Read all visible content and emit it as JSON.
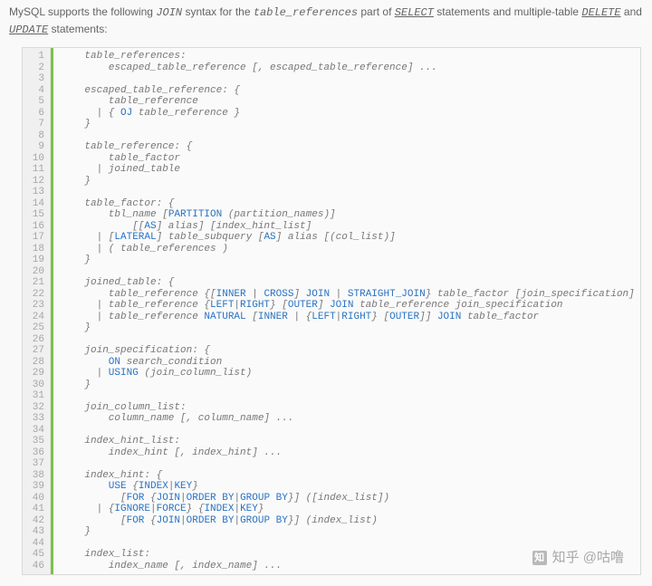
{
  "intro": {
    "t1": "MySQL supports the following ",
    "join": "JOIN",
    "t2": " syntax for the ",
    "tr": "table_references",
    "t3": " part of ",
    "sel": "SELECT",
    "t4": " statements and multiple-table ",
    "del": "DELETE",
    "t5": " and ",
    "upd": "UPDATE",
    "t6": " statements:"
  },
  "lines": 46,
  "code": [
    {
      "t": "table_references:",
      "i": 1
    },
    {
      "t": "escaped_table_reference [, escaped_table_reference] ...",
      "i": 2
    },
    {
      "t": "",
      "i": 0
    },
    {
      "t": "escaped_table_reference: {",
      "i": 1
    },
    {
      "t": "table_reference",
      "i": 2
    },
    {
      "seg": [
        {
          "p": "  | { "
        },
        {
          "k": "OJ"
        },
        {
          "p": " table_reference }"
        }
      ],
      "i": 1
    },
    {
      "t": "}",
      "i": 1
    },
    {
      "t": "",
      "i": 0
    },
    {
      "t": "table_reference: {",
      "i": 1
    },
    {
      "t": "table_factor",
      "i": 2
    },
    {
      "t": "  | joined_table",
      "i": 1
    },
    {
      "t": "}",
      "i": 1
    },
    {
      "t": "",
      "i": 0
    },
    {
      "t": "table_factor: {",
      "i": 1
    },
    {
      "seg": [
        {
          "p": "tbl_name ["
        },
        {
          "k": "PARTITION"
        },
        {
          "p": " (partition_names)]"
        }
      ],
      "i": 2
    },
    {
      "seg": [
        {
          "p": "    [["
        },
        {
          "k": "AS"
        },
        {
          "p": "] alias] [index_hint_list]"
        }
      ],
      "i": 2
    },
    {
      "seg": [
        {
          "p": "  | ["
        },
        {
          "k": "LATERAL"
        },
        {
          "p": "] table_subquery ["
        },
        {
          "k": "AS"
        },
        {
          "p": "] alias [(col_list)]"
        }
      ],
      "i": 1
    },
    {
      "t": "  | ( table_references )",
      "i": 1
    },
    {
      "t": "}",
      "i": 1
    },
    {
      "t": "",
      "i": 0
    },
    {
      "t": "joined_table: {",
      "i": 1
    },
    {
      "seg": [
        {
          "p": "table_reference {["
        },
        {
          "k": "INNER"
        },
        {
          "p": " | "
        },
        {
          "k": "CROSS"
        },
        {
          "p": "] "
        },
        {
          "k": "JOIN"
        },
        {
          "p": " | "
        },
        {
          "k": "STRAIGHT_JOIN"
        },
        {
          "p": "} table_factor [join_specification]"
        }
      ],
      "i": 2
    },
    {
      "seg": [
        {
          "p": "  | table_reference {"
        },
        {
          "k": "LEFT"
        },
        {
          "p": "|"
        },
        {
          "k": "RIGHT"
        },
        {
          "p": "} ["
        },
        {
          "k": "OUTER"
        },
        {
          "p": "] "
        },
        {
          "k": "JOIN"
        },
        {
          "p": " table_reference join_specification"
        }
      ],
      "i": 1
    },
    {
      "seg": [
        {
          "p": "  | table_reference "
        },
        {
          "k": "NATURAL"
        },
        {
          "p": " ["
        },
        {
          "k": "INNER"
        },
        {
          "p": " | {"
        },
        {
          "k": "LEFT"
        },
        {
          "p": "|"
        },
        {
          "k": "RIGHT"
        },
        {
          "p": "} ["
        },
        {
          "k": "OUTER"
        },
        {
          "p": "]] "
        },
        {
          "k": "JOIN"
        },
        {
          "p": " table_factor"
        }
      ],
      "i": 1
    },
    {
      "t": "}",
      "i": 1
    },
    {
      "t": "",
      "i": 0
    },
    {
      "t": "join_specification: {",
      "i": 1
    },
    {
      "seg": [
        {
          "p": "    "
        },
        {
          "k": "ON"
        },
        {
          "p": " search_condition"
        }
      ],
      "i": 1
    },
    {
      "seg": [
        {
          "p": "  | "
        },
        {
          "k": "USING"
        },
        {
          "p": " (join_column_list)"
        }
      ],
      "i": 1
    },
    {
      "t": "}",
      "i": 1
    },
    {
      "t": "",
      "i": 0
    },
    {
      "t": "join_column_list:",
      "i": 1
    },
    {
      "t": "column_name [, column_name] ...",
      "i": 2
    },
    {
      "t": "",
      "i": 0
    },
    {
      "t": "index_hint_list:",
      "i": 1
    },
    {
      "t": "index_hint [, index_hint] ...",
      "i": 2
    },
    {
      "t": "",
      "i": 0
    },
    {
      "t": "index_hint: {",
      "i": 1
    },
    {
      "seg": [
        {
          "p": "    "
        },
        {
          "k": "USE"
        },
        {
          "p": " {"
        },
        {
          "k": "INDEX"
        },
        {
          "p": "|"
        },
        {
          "k": "KEY"
        },
        {
          "p": "}"
        }
      ],
      "i": 1
    },
    {
      "seg": [
        {
          "p": "      ["
        },
        {
          "k": "FOR"
        },
        {
          "p": " {"
        },
        {
          "k": "JOIN"
        },
        {
          "p": "|"
        },
        {
          "k": "ORDER BY"
        },
        {
          "p": "|"
        },
        {
          "k": "GROUP BY"
        },
        {
          "p": "}] ([index_list])"
        }
      ],
      "i": 1
    },
    {
      "seg": [
        {
          "p": "  | {"
        },
        {
          "k": "IGNORE"
        },
        {
          "p": "|"
        },
        {
          "k": "FORCE"
        },
        {
          "p": "} {"
        },
        {
          "k": "INDEX"
        },
        {
          "p": "|"
        },
        {
          "k": "KEY"
        },
        {
          "p": "}"
        }
      ],
      "i": 1
    },
    {
      "seg": [
        {
          "p": "      ["
        },
        {
          "k": "FOR"
        },
        {
          "p": " {"
        },
        {
          "k": "JOIN"
        },
        {
          "p": "|"
        },
        {
          "k": "ORDER BY"
        },
        {
          "p": "|"
        },
        {
          "k": "GROUP BY"
        },
        {
          "p": "}] (index_list)"
        }
      ],
      "i": 1
    },
    {
      "t": "}",
      "i": 1
    },
    {
      "t": "",
      "i": 0
    },
    {
      "t": "index_list:",
      "i": 1
    },
    {
      "t": "index_name [, index_name] ...",
      "i": 2
    }
  ],
  "watermark": {
    "logo": "知",
    "text": "知乎 @咕噜"
  }
}
